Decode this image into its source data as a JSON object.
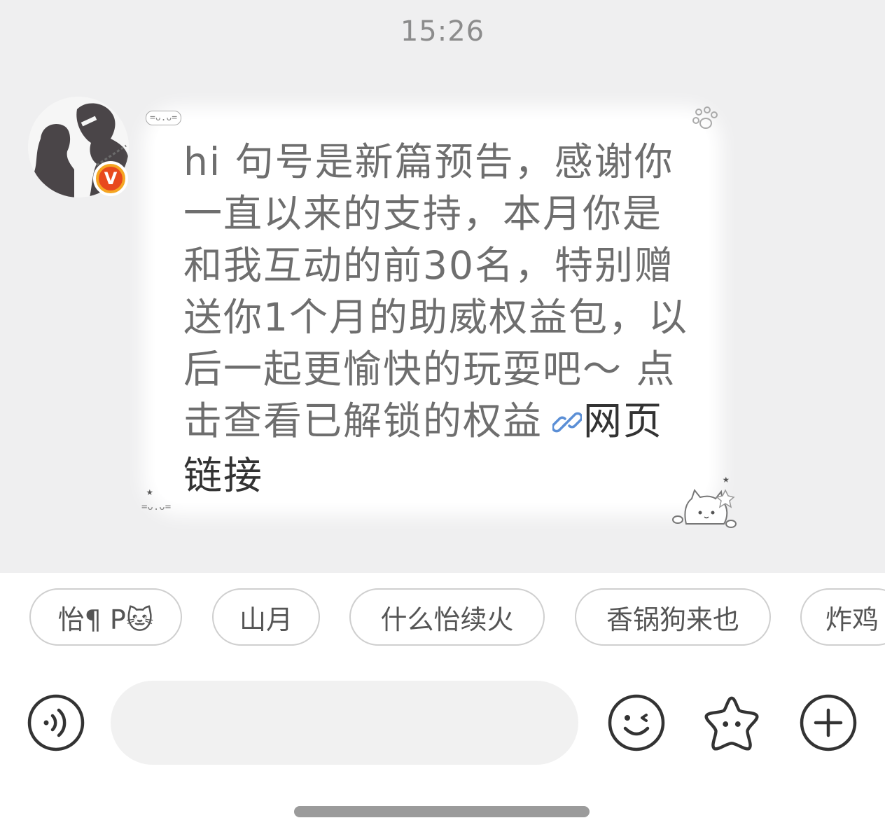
{
  "status": {
    "time": "15:26"
  },
  "message": {
    "text": "hi 句号是新篇预告，感谢你一直以来的支持，本月你是和我互动的前30名，特别赠送你1个月的助威权益包，以后一起更愉快的玩耍吧～ 点击查看已解锁的权益",
    "link_label": "网页链接",
    "link_icon": "link-icon",
    "decorations": {
      "top_left_face": "=ᴗ.ᴗ=",
      "bottom_left_face": "=ᴗ.ᴗ="
    }
  },
  "avatar": {
    "badge": "V",
    "badge_color": "#f5a623"
  },
  "suggestions": [
    {
      "label": "怡¶ P🐱"
    },
    {
      "label": "山月"
    },
    {
      "label": "什么怡续火"
    },
    {
      "label": "香锅狗来也"
    },
    {
      "label": "炸鸡"
    }
  ],
  "input": {
    "value": "",
    "placeholder": ""
  },
  "toolbar": {
    "voice_icon": "voice-icon",
    "emoji_icon": "emoji-icon",
    "sticker_icon": "star-sticker-icon",
    "add_icon": "plus-icon"
  }
}
